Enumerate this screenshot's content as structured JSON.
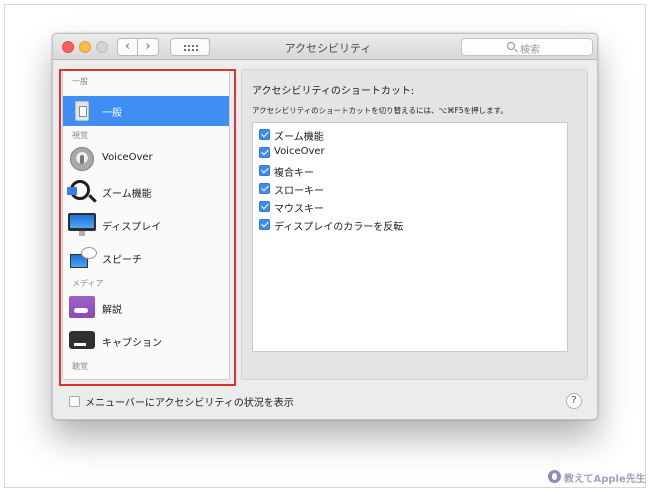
{
  "window": {
    "title": "アクセシビリティ",
    "nav_back": "‹",
    "nav_forward": "›",
    "search_placeholder": "検索"
  },
  "sidebar": {
    "sections": [
      {
        "label": "一般"
      },
      {
        "label": "視覚"
      },
      {
        "label": "メディア"
      },
      {
        "label": "聴覚"
      }
    ],
    "items": [
      {
        "label": "一般",
        "icon": "general-icon",
        "selected": true
      },
      {
        "label": "VoiceOver",
        "icon": "voiceover-icon"
      },
      {
        "label": "ズーム機能",
        "icon": "zoom-icon"
      },
      {
        "label": "ディスプレイ",
        "icon": "display-icon"
      },
      {
        "label": "スピーチ",
        "icon": "speech-icon"
      },
      {
        "label": "解説",
        "icon": "descriptions-icon"
      },
      {
        "label": "キャプション",
        "icon": "captions-icon"
      }
    ]
  },
  "pane": {
    "title": "アクセシビリティのショートカット:",
    "subtitle": "アクセシビリティのショートカットを切り替えるには、⌥⌘F5を押します。",
    "options": [
      {
        "label": "ズーム機能",
        "checked": true
      },
      {
        "label": "VoiceOver",
        "checked": true
      },
      {
        "label": "複合キー",
        "checked": true
      },
      {
        "label": "スローキー",
        "checked": true
      },
      {
        "label": "マウスキー",
        "checked": true
      },
      {
        "label": "ディスプレイのカラーを反転",
        "checked": true
      }
    ]
  },
  "footer": {
    "menubar_checkbox_label": "メニューバーにアクセシビリティの状況を表示",
    "menubar_checked": false,
    "help": "?"
  },
  "watermark": {
    "text": "教えてApple先生"
  },
  "colors": {
    "accent": "#3e8ef3",
    "highlight_outline": "#e0312c"
  }
}
